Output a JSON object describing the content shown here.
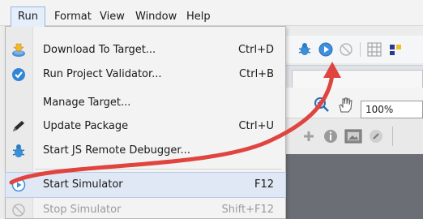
{
  "menubar": {
    "items": [
      {
        "label": "Run"
      },
      {
        "label": "Format"
      },
      {
        "label": "View"
      },
      {
        "label": "Window"
      },
      {
        "label": "Help"
      }
    ]
  },
  "run_menu": {
    "items": [
      {
        "label": "Download To Target...",
        "shortcut": "Ctrl+D",
        "icon": "download-to-target-icon"
      },
      {
        "label": "Run Project Validator...",
        "shortcut": "Ctrl+B",
        "icon": "check-circle-icon"
      },
      {
        "label": "Manage Target...",
        "shortcut": "",
        "icon": ""
      },
      {
        "label": "Update Package",
        "shortcut": "Ctrl+U",
        "icon": "pen-icon"
      },
      {
        "label": "Start JS Remote Debugger...",
        "shortcut": "",
        "icon": "bug-icon"
      },
      {
        "label": "Start Simulator",
        "shortcut": "F12",
        "icon": "play-circle-icon"
      },
      {
        "label": "Stop Simulator",
        "shortcut": "Shift+F12",
        "icon": "stop-simulator-icon",
        "disabled": true
      }
    ]
  },
  "toolbar": {
    "zoom_value": "100%"
  },
  "colors": {
    "annotation_arrow": "#e0443f",
    "menu_highlight": "#e0e8f5",
    "check_icon": "#2f86d9",
    "bug_icon": "#3a8fd6",
    "disabled_text": "#9b9b9b"
  }
}
